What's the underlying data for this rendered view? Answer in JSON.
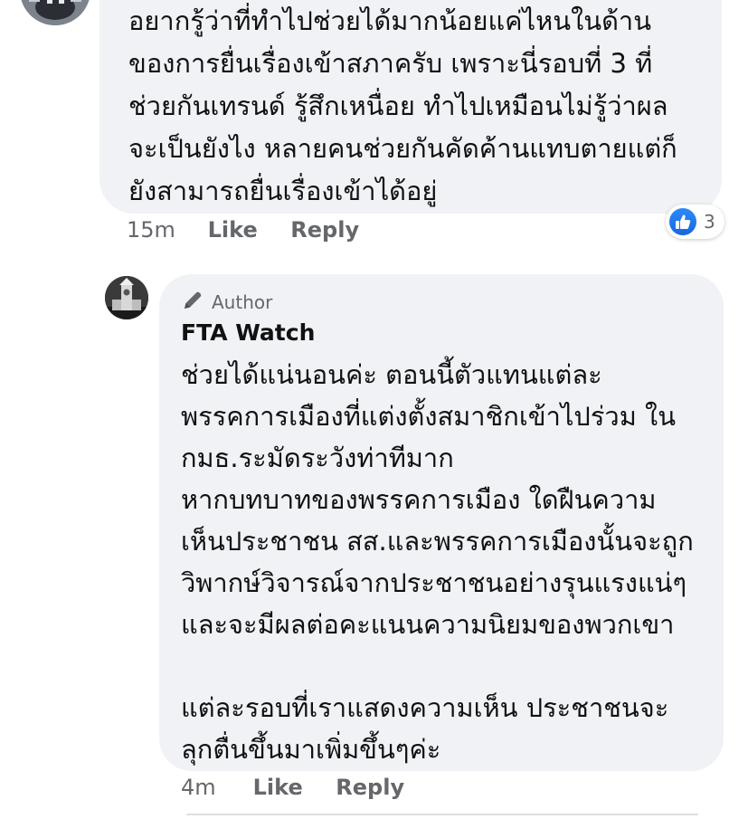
{
  "comment_prev": {
    "lines": [
      "อยากรู้ว่าที่ทำไปช่วยได้มากน้อยแค่ไหนในด้าน",
      "ของการยื่นเรื่องเข้าสภาครับ เพราะนี่รอบที่ 3 ที่",
      "ช่วยกันเทรนด์ รู้สึกเหนื่อย ทำไปเหมือนไม่รู้ว่าผล",
      "จะเป็นยังไง หลายคนช่วยกันคัดค้านแทบตายแต่ก็",
      "ยังสามารถยื่นเรื่องเข้าได้อยู่"
    ],
    "time": "15m",
    "like_label": "Like",
    "reply_label": "Reply",
    "reaction_icon": "thumbs-up-icon",
    "reaction_count": "3"
  },
  "comment_reply": {
    "badge_icon": "pencil-icon",
    "badge_label": "Author",
    "name": "FTA Watch",
    "lines": [
      "ช่วยได้แน่นอนค่ะ ตอนนี้ตัวแทนแต่ละ",
      "พรรคการเมืองที่แต่งตั้งสมาชิกเข้าไปร่วม ใน",
      "กมธ.ระมัดระวังท่าทีมาก",
      "หากบทบาทของพรรคการเมือง ใดฝืนความ",
      "เห็นประชาชน สส.และพรรคการเมืองนั้นจะถูก",
      "วิพากษ์วิจารณ์จากประชาชนอย่างรุนแรงแน่ๆ",
      "และจะมีผลต่อคะแนนความนิยมของพวกเขา",
      "",
      "แต่ละรอบที่เราแสดงความเห็น ประชาชนจะ",
      "ลุกตื่นขึ้นมาเพิ่มขึ้นๆค่ะ"
    ],
    "time": "4m",
    "like_label": "Like",
    "reply_label": "Reply"
  },
  "colors": {
    "bubble": "#f0f2f5",
    "meta_text": "#65676b",
    "like_blue": "#1877f2"
  }
}
